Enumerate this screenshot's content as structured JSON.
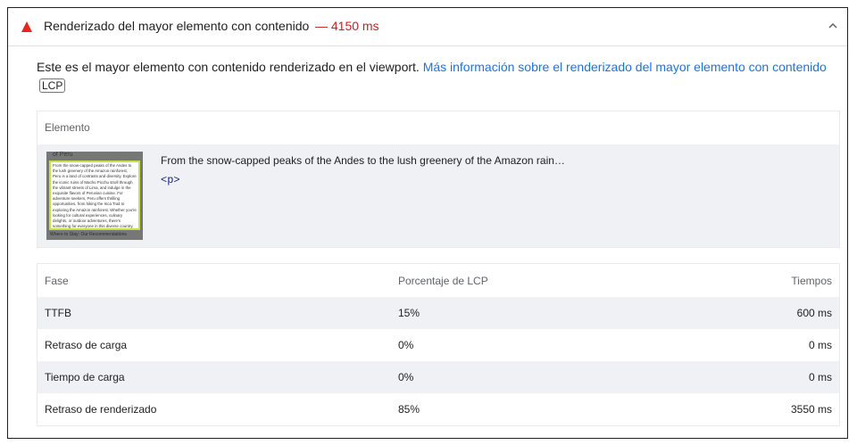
{
  "header": {
    "title": "Renderizado del mayor elemento con contenido",
    "metric": "— 4150 ms",
    "warning_color": "#e8251f",
    "metric_color": "#c5221f"
  },
  "description": {
    "text": "Este es el mayor elemento con contenido renderizado en el viewport. ",
    "link": "Más información sobre el renderizado del mayor elemento con contenido",
    "badge": "LCP",
    "link_color": "#1a73e8"
  },
  "element_table": {
    "header": "Elemento",
    "element_text": "From the snow-capped peaks of the Andes to the lush greenery of the Amazon rain…",
    "element_tag": "<p>",
    "thumbnail": {
      "top_text": "of Peru",
      "body_text": "From the snow-capped peaks of the Andes to the lush greenery of the Amazon rainforest, Peru is a land of contrasts and diversity. Explore the iconic ruins of Machu Picchu stroll through the vibrant streets of Lima, and indulge in the exquisite flavors of Peruvian cuisine. For adventure seekers, Peru offers thrilling opportunities, from hiking the Inca Trail to exploring the Amazon rainforest. Whether you're looking for cultural experiences, culinary delights, or outdoor adventures, there's something for everyone in this diverse country.",
      "bottom_text": "Where to Stay: Our Recommendations"
    }
  },
  "phase_table": {
    "headers": [
      "Fase",
      "Porcentaje de LCP",
      "Tiempos"
    ],
    "rows": [
      {
        "phase": "TTFB",
        "percent": "15%",
        "time": "600 ms"
      },
      {
        "phase": "Retraso de carga",
        "percent": "0%",
        "time": "0 ms"
      },
      {
        "phase": "Tiempo de carga",
        "percent": "0%",
        "time": "0 ms"
      },
      {
        "phase": "Retraso de renderizado",
        "percent": "85%",
        "time": "3550 ms"
      }
    ]
  },
  "icons": {
    "warning": "warning-triangle-icon",
    "collapse": "chevron-up-icon"
  }
}
